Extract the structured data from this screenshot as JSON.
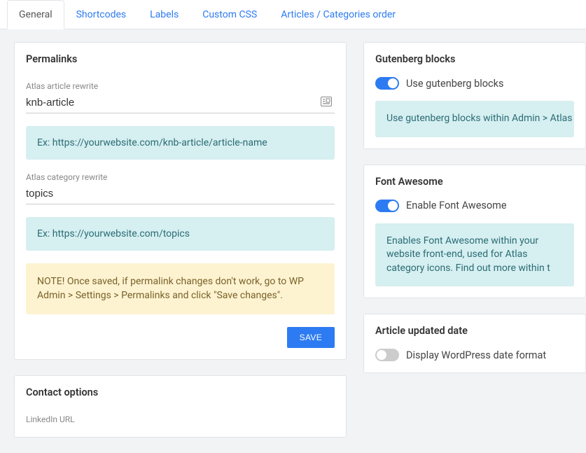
{
  "tabs": {
    "general": "General",
    "shortcodes": "Shortcodes",
    "labels": "Labels",
    "custom_css": "Custom CSS",
    "articles_order": "Articles / Categories order"
  },
  "permalinks": {
    "title": "Permalinks",
    "article_rewrite_label": "Atlas article rewrite",
    "article_rewrite_value": "knb-article",
    "article_hint": "Ex: https://yourwebsite.com/knb-article/article-name",
    "category_rewrite_label": "Atlas category rewrite",
    "category_rewrite_value": "topics",
    "category_hint": "Ex: https://yourwebsite.com/topics",
    "note": "NOTE! Once saved, if permalink changes don't work, go to WP Admin > Settings > Permalinks and click \"Save changes\".",
    "save_label": "SAVE"
  },
  "contact": {
    "title": "Contact options",
    "linkedin_label": "LinkedIn URL"
  },
  "gutenberg": {
    "title": "Gutenberg blocks",
    "toggle_label": "Use gutenberg blocks",
    "info": "Use gutenberg blocks within Admin > Atlas articles."
  },
  "fontawesome": {
    "title": "Font Awesome",
    "toggle_label": "Enable Font Awesome",
    "info": "Enables Font Awesome within your website front-end, used for Atlas category icons. Find out more within t"
  },
  "article_date": {
    "title": "Article updated date",
    "toggle_label": "Display WordPress date format"
  }
}
